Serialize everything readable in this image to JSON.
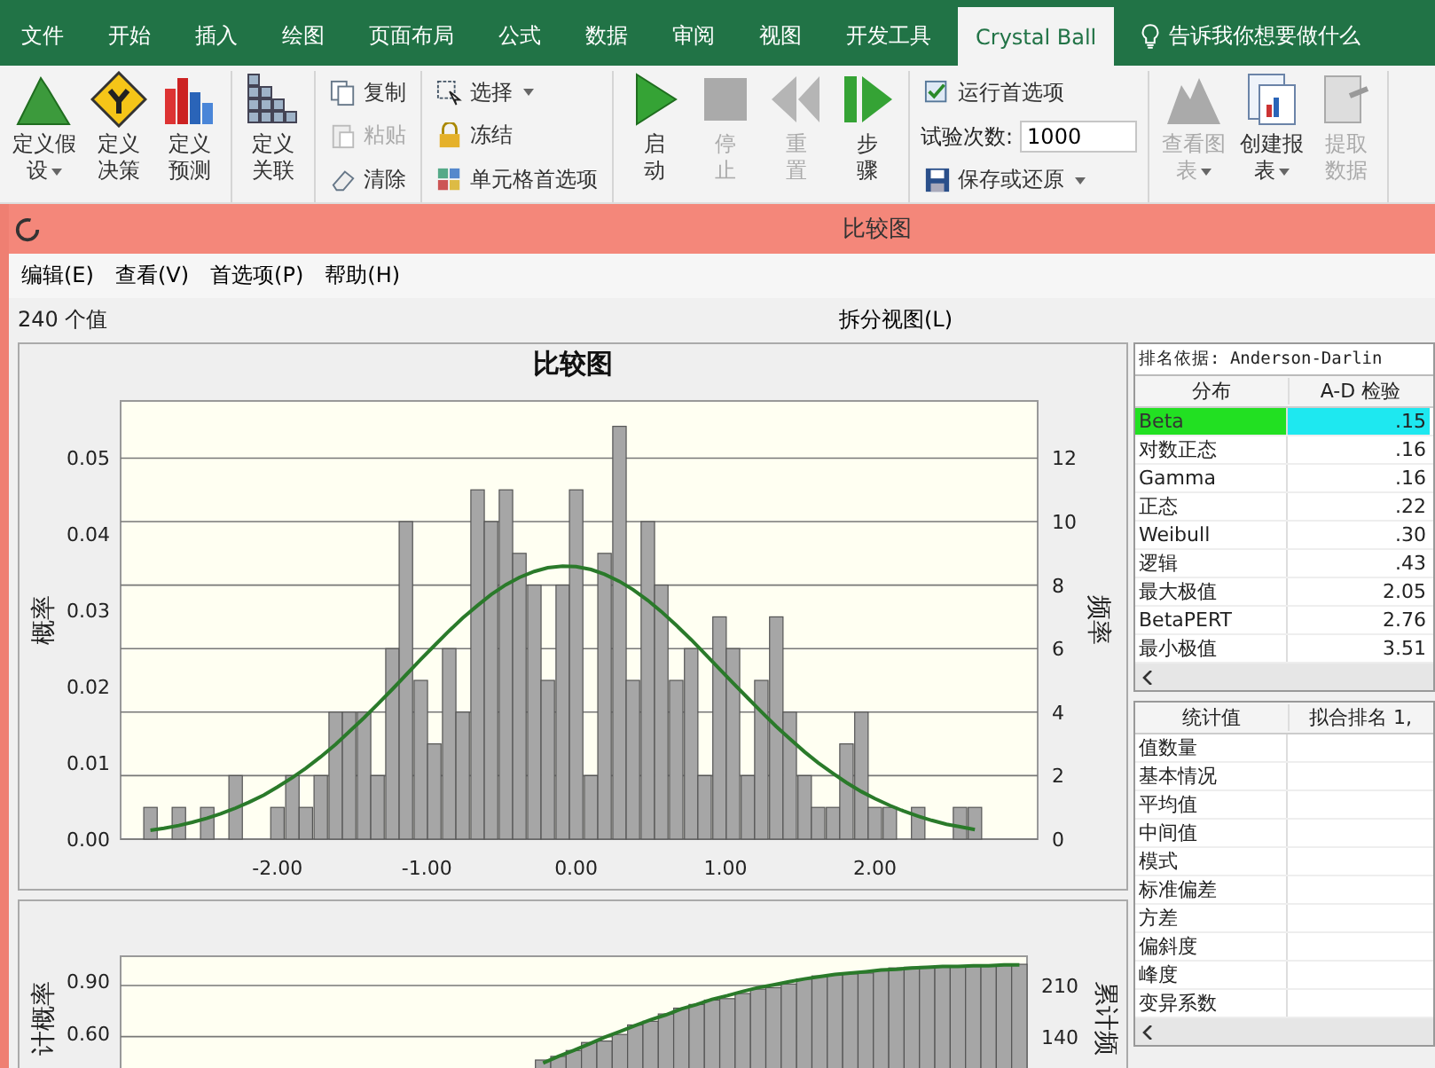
{
  "ribbon": {
    "tabs": [
      {
        "label": "文件",
        "selected": false
      },
      {
        "label": "开始",
        "selected": false
      },
      {
        "label": "插入",
        "selected": false
      },
      {
        "label": "绘图",
        "selected": false
      },
      {
        "label": "页面布局",
        "selected": false
      },
      {
        "label": "公式",
        "selected": false
      },
      {
        "label": "数据",
        "selected": false
      },
      {
        "label": "审阅",
        "selected": false
      },
      {
        "label": "视图",
        "selected": false
      },
      {
        "label": "开发工具",
        "selected": false
      },
      {
        "label": "Crystal Ball",
        "selected": true
      }
    ],
    "tell_me": "告诉我你想要做什么",
    "sections": [
      {
        "kind": "large",
        "buttons": [
          {
            "label": "定义假设",
            "dropdown": true,
            "disabled": false
          },
          {
            "label": "定义决策",
            "dropdown": false,
            "disabled": false
          },
          {
            "label": "定义预测",
            "dropdown": false,
            "disabled": false
          }
        ]
      },
      {
        "kind": "large",
        "buttons": [
          {
            "label": "定义关联",
            "dropdown": false,
            "disabled": false
          }
        ]
      },
      {
        "kind": "small",
        "buttons": [
          {
            "kind": "button",
            "label": "复制",
            "dropdown": false,
            "disabled": false
          },
          {
            "kind": "button",
            "label": "粘贴",
            "dropdown": false,
            "disabled": true
          },
          {
            "kind": "button",
            "label": "清除",
            "dropdown": false,
            "disabled": false
          }
        ]
      },
      {
        "kind": "small",
        "buttons": [
          {
            "kind": "button",
            "label": "选择",
            "dropdown": true,
            "disabled": false
          },
          {
            "kind": "button",
            "label": "冻结",
            "dropdown": false,
            "disabled": false
          },
          {
            "kind": "button",
            "label": "单元格首选项",
            "dropdown": false,
            "disabled": false
          }
        ]
      },
      {
        "kind": "large",
        "buttons": [
          {
            "label": "启动",
            "dropdown": false,
            "disabled": false
          },
          {
            "label": "停止",
            "dropdown": false,
            "disabled": true
          },
          {
            "label": "重置",
            "dropdown": false,
            "disabled": true
          },
          {
            "label": "步骤",
            "dropdown": false,
            "disabled": false
          }
        ]
      },
      {
        "kind": "small",
        "buttons": [
          {
            "kind": "button",
            "label": "运行首选项",
            "dropdown": false,
            "disabled": false
          },
          {
            "kind": "field",
            "label": "试验次数:",
            "value": "1000"
          },
          {
            "kind": "button",
            "label": "保存或还原",
            "dropdown": true,
            "disabled": false
          }
        ]
      },
      {
        "kind": "large",
        "buttons": [
          {
            "label": "查看图表",
            "dropdown": true,
            "disabled": true
          },
          {
            "label": "创建报表",
            "dropdown": true,
            "disabled": false
          },
          {
            "label": "提取数据",
            "dropdown": false,
            "disabled": true
          }
        ]
      }
    ]
  },
  "window": {
    "title": "比较图",
    "menu": [
      "编辑(E)",
      "查看(V)",
      "首选项(P)",
      "帮助(H)"
    ],
    "count": "240 个值",
    "split_view": "拆分视图(L)"
  },
  "histogram": {
    "chart_data": {
      "type": "bar",
      "title": "比较图",
      "ylabel": "频率",
      "y2label": "概率",
      "x": [
        -2.85,
        -2.76,
        -2.66,
        -2.57,
        -2.47,
        -2.38,
        -2.28,
        -2.19,
        -2.09,
        -2.0,
        -1.9,
        -1.81,
        -1.71,
        -1.61,
        -1.52,
        -1.42,
        -1.33,
        -1.23,
        -1.14,
        -1.04,
        -0.95,
        -0.85,
        -0.76,
        -0.66,
        -0.57,
        -0.47,
        -0.38,
        -0.28,
        -0.19,
        -0.09,
        0.0,
        0.1,
        0.19,
        0.29,
        0.38,
        0.48,
        0.57,
        0.67,
        0.77,
        0.86,
        0.96,
        1.05,
        1.15,
        1.24,
        1.34,
        1.43,
        1.53,
        1.62,
        1.72,
        1.81,
        1.91,
        2.0,
        2.1,
        2.19,
        2.29,
        2.38,
        2.48,
        2.57,
        2.67
      ],
      "series": [
        {
          "type": "bar",
          "color": "#a6a6a6",
          "values": [
            1,
            0,
            1,
            0,
            1,
            0,
            2,
            0,
            0,
            1,
            2,
            1,
            2,
            4,
            4,
            4,
            2,
            6,
            10,
            5,
            3,
            6,
            4,
            11,
            10,
            11,
            9,
            8,
            5,
            8,
            11,
            2,
            9,
            13,
            5,
            10,
            8,
            5,
            6,
            2,
            7,
            6,
            2,
            5,
            7,
            4,
            2,
            1,
            1,
            3,
            4,
            1,
            1,
            0,
            1,
            0,
            0,
            1,
            1
          ]
        },
        {
          "type": "line",
          "color": "#2a7a2a",
          "values": [
            0.28,
            0.34,
            0.43,
            0.53,
            0.66,
            0.8,
            0.98,
            1.16,
            1.39,
            1.64,
            1.94,
            2.23,
            2.59,
            2.99,
            3.38,
            3.82,
            4.24,
            4.72,
            5.17,
            5.66,
            6.09,
            6.56,
            6.96,
            7.36,
            7.7,
            8.01,
            8.24,
            8.43,
            8.55,
            8.6,
            8.58,
            8.49,
            8.34,
            8.12,
            7.86,
            7.52,
            7.17,
            6.74,
            6.28,
            5.85,
            5.36,
            4.92,
            4.44,
            4.01,
            3.55,
            3.16,
            2.75,
            2.41,
            2.07,
            1.78,
            1.5,
            1.28,
            1.06,
            0.89,
            0.72,
            0.59,
            0.47,
            0.39,
            0.3
          ]
        }
      ],
      "xlim": [
        -3.05,
        3.09
      ],
      "ylim": [
        0,
        13.8
      ],
      "y2lim": [
        0,
        0.0575
      ],
      "grid": true,
      "xticks": [
        {
          "value": -2,
          "label": "-2.00"
        },
        {
          "value": -1,
          "label": "-1.00"
        },
        {
          "value": 0,
          "label": "0.00"
        },
        {
          "value": 1,
          "label": "1.00"
        },
        {
          "value": 2,
          "label": "2.00"
        }
      ],
      "yticks": [
        0,
        2,
        4,
        6,
        8,
        10,
        12
      ],
      "y2ticks": [
        {
          "value": 0,
          "label": "0.00"
        },
        {
          "value": 0.01,
          "label": "0.01"
        },
        {
          "value": 0.02,
          "label": "0.02"
        },
        {
          "value": 0.03,
          "label": "0.03"
        },
        {
          "value": 0.04,
          "label": "0.04"
        },
        {
          "value": 0.05,
          "label": "0.05"
        }
      ]
    }
  },
  "cumulative": {
    "chart_data": {
      "type": "bar",
      "ylabel": "累计频",
      "y2label": "计概率",
      "categories": [
        null,
        null,
        null,
        null,
        null,
        null,
        null,
        null,
        null,
        null,
        null,
        null,
        null,
        null,
        null,
        null,
        null,
        null,
        null,
        null,
        null,
        null,
        null,
        null,
        null,
        null,
        null,
        null,
        null,
        null,
        null,
        null,
        null,
        null,
        null,
        null,
        null,
        null,
        null,
        null,
        null,
        null,
        null,
        null,
        null,
        null,
        null,
        null,
        null,
        null,
        null,
        null,
        null,
        null,
        null,
        null,
        null,
        null,
        null
      ],
      "series": [
        {
          "type": "bar",
          "color": "#a6a6a6",
          "values": [
            null,
            null,
            null,
            null,
            null,
            null,
            null,
            null,
            null,
            null,
            null,
            null,
            null,
            null,
            null,
            null,
            null,
            null,
            null,
            null,
            null,
            null,
            null,
            null,
            null,
            null,
            null,
            108,
            113,
            121,
            132,
            134,
            143,
            156,
            161,
            171,
            179,
            184,
            190,
            192,
            199,
            205,
            207,
            212,
            219,
            223,
            225,
            226,
            227,
            230,
            234,
            235,
            236,
            236,
            237,
            237,
            237,
            238,
            239
          ]
        },
        {
          "type": "line",
          "color": "#2a7a2a",
          "values": [
            null,
            null,
            null,
            null,
            null,
            null,
            null,
            null,
            null,
            null,
            null,
            null,
            null,
            null,
            null,
            null,
            null,
            null,
            null,
            null,
            null,
            null,
            null,
            null,
            null,
            null,
            null,
            104,
            113,
            121,
            130,
            139,
            147,
            155,
            163,
            170,
            178,
            184,
            191,
            196,
            202,
            207,
            211,
            215,
            219,
            222,
            225,
            227,
            229,
            231,
            232,
            234,
            235,
            236,
            236,
            237,
            237,
            238,
            238
          ]
        }
      ],
      "ylim": [
        0,
        250
      ],
      "y2lim": [
        0,
        1.042
      ],
      "grid": true,
      "yticks": [
        140,
        210
      ],
      "y2ticks": [
        {
          "value": 0.6,
          "label": "0.60"
        },
        {
          "value": 0.9,
          "label": "0.90"
        }
      ]
    }
  },
  "ranking": {
    "caption": "排名依据: Anderson-Darlin",
    "columns": [
      "分布",
      "A-D 检验"
    ],
    "rows": [
      {
        "distribution": "Beta",
        "score": ".15",
        "selected": true
      },
      {
        "distribution": "对数正态",
        "score": ".16",
        "selected": false
      },
      {
        "distribution": "Gamma",
        "score": ".16",
        "selected": false
      },
      {
        "distribution": "正态",
        "score": ".22",
        "selected": false
      },
      {
        "distribution": "Weibull",
        "score": ".30",
        "selected": false
      },
      {
        "distribution": "逻辑",
        "score": ".43",
        "selected": false
      },
      {
        "distribution": "最大极值",
        "score": "2.05",
        "selected": false
      },
      {
        "distribution": "BetaPERT",
        "score": "2.76",
        "selected": false
      },
      {
        "distribution": "最小极值",
        "score": "3.51",
        "selected": false
      }
    ]
  },
  "statistics": {
    "columns": [
      "统计值",
      "拟合排名 1,"
    ],
    "rows": [
      "值数量",
      "基本情况",
      "平均值",
      "中间值",
      "模式",
      "标准偏差",
      "方差",
      "偏斜度",
      "峰度",
      "变异系数"
    ]
  }
}
